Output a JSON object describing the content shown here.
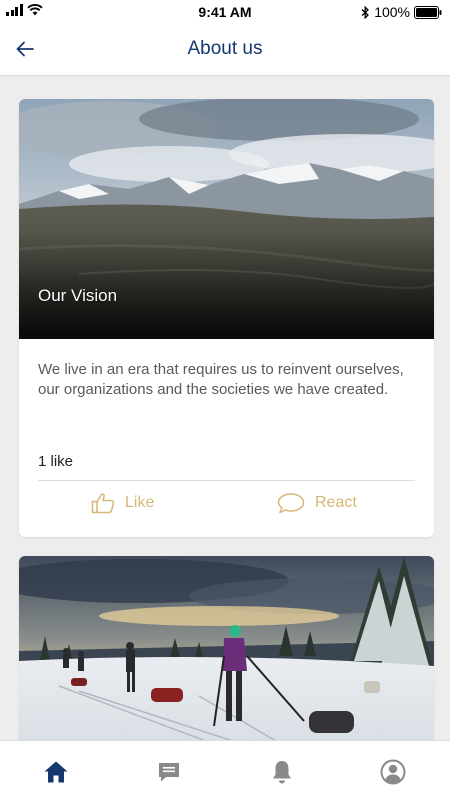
{
  "status_bar": {
    "time": "9:41 AM",
    "battery": "100%",
    "icons": [
      "signal-icon",
      "wifi-icon",
      "bluetooth-icon",
      "battery-icon"
    ]
  },
  "header": {
    "title": "About us",
    "back_icon": "back-arrow-icon"
  },
  "cards": [
    {
      "image_title": "Our Vision",
      "text": "We live in an era that requires us to reinvent ourselves, our organizations and the societies we have created.",
      "like_count": "1 like",
      "like_label": "Like",
      "react_label": "React"
    },
    {
      "image_title": ""
    }
  ],
  "tab_bar": {
    "items": [
      "home-icon",
      "messages-icon",
      "notifications-icon",
      "profile-icon"
    ],
    "active": "home-icon"
  },
  "colors": {
    "title": "#14386f",
    "accent_gold": "#d6b776",
    "active_tab": "#14386f",
    "inactive_tab": "#8a8a8a"
  }
}
